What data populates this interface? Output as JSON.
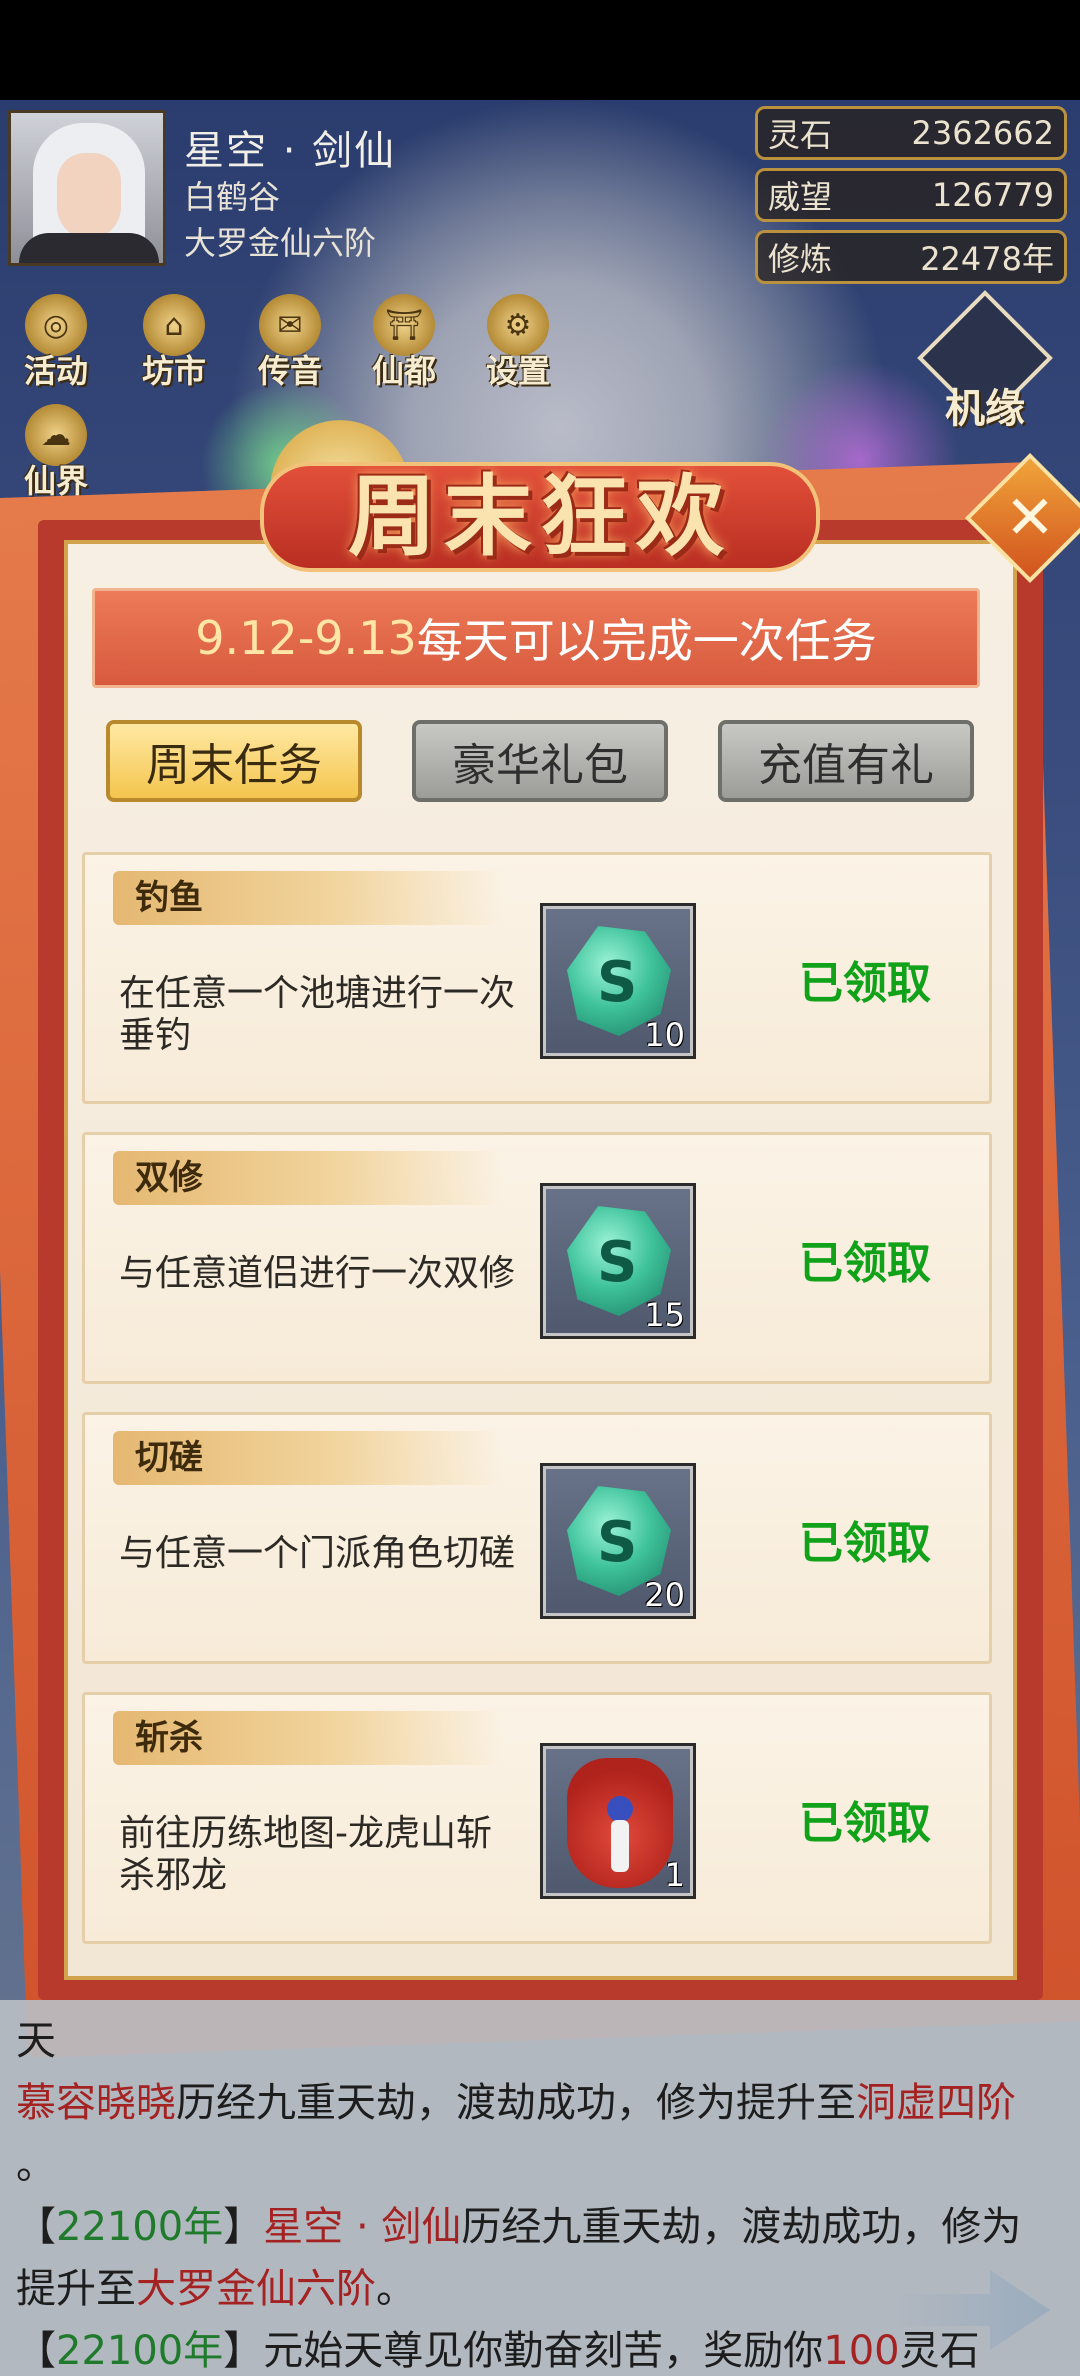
{
  "header": {
    "character": {
      "name": "星空 · 剑仙",
      "sect": "白鹤谷",
      "rank": "大罗金仙六阶"
    },
    "stats": [
      {
        "label": "灵石",
        "value": "2362662"
      },
      {
        "label": "威望",
        "value": "126779"
      },
      {
        "label": "修炼",
        "value": "22478年"
      }
    ],
    "nav": [
      {
        "label": "活动",
        "icon": "coin-icon"
      },
      {
        "label": "坊市",
        "icon": "market-icon"
      },
      {
        "label": "传音",
        "icon": "envelope-icon"
      },
      {
        "label": "仙都",
        "icon": "palace-icon"
      },
      {
        "label": "设置",
        "icon": "gear-icon"
      },
      {
        "label": "仙界",
        "icon": "cloud-icon"
      }
    ],
    "jiyuan_label": "机缘"
  },
  "modal": {
    "title": "周末狂欢",
    "close_symbol": "✕",
    "banner": {
      "date": "9.12-9.13",
      "text": "每天可以完成一次任务"
    },
    "tabs": [
      {
        "label": "周末任务",
        "active": true
      },
      {
        "label": "豪华礼包",
        "active": false
      },
      {
        "label": "充值有礼",
        "active": false
      }
    ],
    "tasks": [
      {
        "tag": "钓鱼",
        "desc": "在任意一个池塘进行一次垂钓",
        "reward": "spirit-stone",
        "count": "10",
        "status": "已领取"
      },
      {
        "tag": "双修",
        "desc": "与任意道侣进行一次双修",
        "reward": "spirit-stone",
        "count": "15",
        "status": "已领取"
      },
      {
        "tag": "切磋",
        "desc": "与任意一个门派角色切磋",
        "reward": "spirit-stone",
        "count": "20",
        "status": "已领取"
      },
      {
        "tag": "斩杀",
        "desc": "前往历练地图-龙虎山斩杀邪龙",
        "reward": "lucky-bag",
        "count": "1",
        "status": "已领取"
      }
    ]
  },
  "log": {
    "partial_top": "天",
    "line1": {
      "name": "慕容晓晓",
      "text": "历经九重天劫，渡劫成功，修为提升至",
      "realm": "洞虚四阶"
    },
    "line1_end": "。",
    "line2": {
      "open": "【",
      "year": "22100年",
      "close": "】",
      "name": "星空 · 剑仙",
      "text": "历经九重天劫，渡劫成功，修为"
    },
    "line3": {
      "prefix": "提升至",
      "realm": "大罗金仙六阶",
      "end": "。"
    },
    "line4": {
      "open": "【",
      "year": "22100年",
      "close": "】",
      "text": "元始天尊见你勤奋刻苦，奖励你",
      "amount": "100",
      "tail": "灵石"
    }
  },
  "colors": {
    "accent_red": "#b73a2c",
    "gold": "#d3a44d",
    "claimed_green": "#12a21a",
    "log_name_red": "#a52222",
    "log_year_green": "#1f7a2c"
  }
}
